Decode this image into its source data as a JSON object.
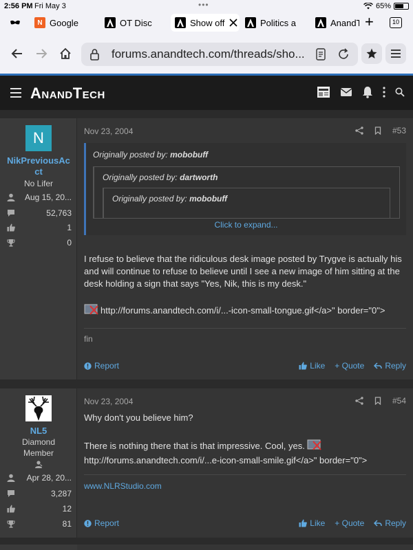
{
  "status": {
    "time": "2:56 PM",
    "date": "Fri May 3",
    "battery": "65%",
    "battery_level": 0.65
  },
  "tabs": [
    {
      "label": "",
      "icon": "mask-icon"
    },
    {
      "label": "Google",
      "icon": "google-favicon"
    },
    {
      "label": "OT Disc",
      "icon": "anandtech-favicon"
    },
    {
      "label": "Show off",
      "icon": "anandtech-favicon",
      "active": true
    },
    {
      "label": "Politics a",
      "icon": "anandtech-favicon"
    },
    {
      "label": "AnandT",
      "icon": "anandtech-favicon"
    }
  ],
  "tab_count": "10",
  "toolbar": {
    "url": "forums.anandtech.com/threads/sho..."
  },
  "site": {
    "logo": "AnandTech"
  },
  "posts": [
    {
      "username": "NikPreviousAct",
      "username_line1": "NikPreviousAc",
      "username_line2": "ct",
      "avatar_letter": "N",
      "title": "No Lifer",
      "joined": "Aug 15, 20...",
      "messages": "52,763",
      "reactions": "1",
      "points": "0",
      "date": "Nov 23, 2004",
      "number": "#53",
      "quotes": [
        "Originally posted by: mobobuff",
        "Originally posted by: dartworth",
        "Originally posted by: mobobuff"
      ],
      "quote_authors": [
        "mobobuff",
        "dartworth",
        "mobobuff"
      ],
      "quote_prefix": "Originally posted by: ",
      "expand": "Click to expand...",
      "body": "I refuse to believe that the ridiculous desk image posted by Trygve is actually his and will continue to refuse to believe until I see a new image of him sitting at the desk holding a sign that says \"Yes, Nik, this is my desk.\"",
      "img_text": "http://forums.anandtech.com/i/...-icon-small-tongue.gif</a>\" border=\"0\">",
      "signature": "fin"
    },
    {
      "username": "NL5",
      "title_line1": "Diamond",
      "title_line2": "Member",
      "joined": "Apr 28, 20...",
      "messages": "3,287",
      "reactions": "12",
      "points": "81",
      "date": "Nov 23, 2004",
      "number": "#54",
      "body_line1": "Why don't you believe him?",
      "body_line2": "There is nothing there that is that impressive. Cool, yes.",
      "img_text": "http://forums.anandtech.com/i/...e-icon-small-smile.gif</a>\" border=\"0\">",
      "signature": "www.NLRStudio.com"
    }
  ],
  "actions": {
    "report": "Report",
    "like": "Like",
    "quote": "+ Quote",
    "reply": "Reply"
  },
  "colors": {
    "accent": "#2d6fb8",
    "link": "#5fa9e0",
    "avatar_teal": "#2aa1b8"
  }
}
